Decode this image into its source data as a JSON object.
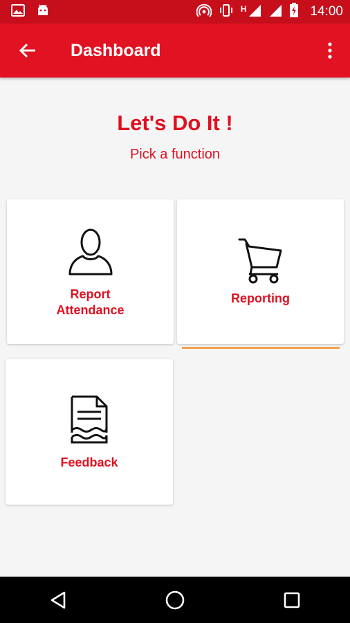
{
  "status_bar": {
    "time": "14:00",
    "network_label": "H",
    "left_icons": [
      "image-icon",
      "android-icon"
    ],
    "right_icons": [
      "hotspot-icon",
      "vibrate-icon",
      "signal-icon",
      "signal-icon",
      "battery-charging-icon"
    ]
  },
  "app_bar": {
    "title": "Dashboard",
    "back_icon": "arrow-back-icon",
    "menu_icon": "more-vert-icon"
  },
  "main": {
    "headline": "Let's Do It !",
    "subtitle": "Pick a function"
  },
  "cards": [
    {
      "label_line1": "Report",
      "label_line2": "Attendance",
      "icon": "person-icon"
    },
    {
      "label": "Reporting",
      "icon": "shopping-cart-icon"
    },
    {
      "label": "Feedback",
      "icon": "document-icon"
    }
  ],
  "nav_bar": {
    "back_icon": "triangle-back-icon",
    "home_icon": "circle-home-icon",
    "recents_icon": "square-recents-icon"
  },
  "colors": {
    "status_bar": "#c70f1c",
    "app_bar": "#e11222",
    "accent_red": "#e01020",
    "selection_indicator": "#f0a24a",
    "background": "#f5f5f5"
  }
}
